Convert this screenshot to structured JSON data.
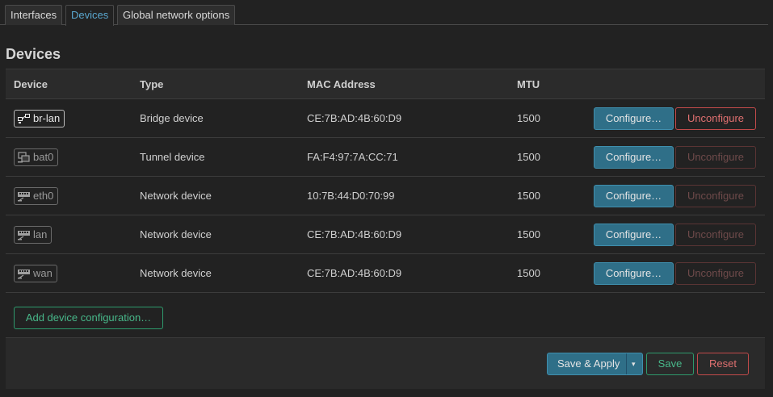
{
  "tabs": [
    {
      "label": "Interfaces",
      "active": false
    },
    {
      "label": "Devices",
      "active": true
    },
    {
      "label": "Global network options",
      "active": false
    }
  ],
  "section_title": "Devices",
  "table": {
    "headers": [
      "Device",
      "Type",
      "MAC Address",
      "MTU"
    ],
    "rows": [
      {
        "device": "br-lan",
        "icon": "bridge-icon",
        "up": true,
        "type": "Bridge device",
        "mac": "CE:7B:AD:4B:60:D9",
        "mtu": "1500",
        "configure_label": "Configure…",
        "unconfigure_label": "Unconfigure",
        "unconfigure_enabled": true
      },
      {
        "device": "bat0",
        "icon": "tunnel-icon",
        "up": false,
        "type": "Tunnel device",
        "mac": "FA:F4:97:7A:CC:71",
        "mtu": "1500",
        "configure_label": "Configure…",
        "unconfigure_label": "Unconfigure",
        "unconfigure_enabled": false
      },
      {
        "device": "eth0",
        "icon": "ethernet-port-icon",
        "up": false,
        "type": "Network device",
        "mac": "10:7B:44:D0:70:99",
        "mtu": "1500",
        "configure_label": "Configure…",
        "unconfigure_label": "Unconfigure",
        "unconfigure_enabled": false
      },
      {
        "device": "lan",
        "icon": "ethernet-port-icon",
        "up": false,
        "type": "Network device",
        "mac": "CE:7B:AD:4B:60:D9",
        "mtu": "1500",
        "configure_label": "Configure…",
        "unconfigure_label": "Unconfigure",
        "unconfigure_enabled": false
      },
      {
        "device": "wan",
        "icon": "ethernet-port-icon",
        "up": false,
        "type": "Network device",
        "mac": "CE:7B:AD:4B:60:D9",
        "mtu": "1500",
        "configure_label": "Configure…",
        "unconfigure_label": "Unconfigure",
        "unconfigure_enabled": false
      }
    ]
  },
  "add_device_label": "Add device configuration…",
  "footer": {
    "save_apply_label": "Save & Apply",
    "save_label": "Save",
    "reset_label": "Reset"
  },
  "colors": {
    "background": "#222222",
    "primary_button": "#2f6f88",
    "positive": "#48b88a",
    "negative": "#e07070",
    "active_tab": "#5aa7cf"
  }
}
